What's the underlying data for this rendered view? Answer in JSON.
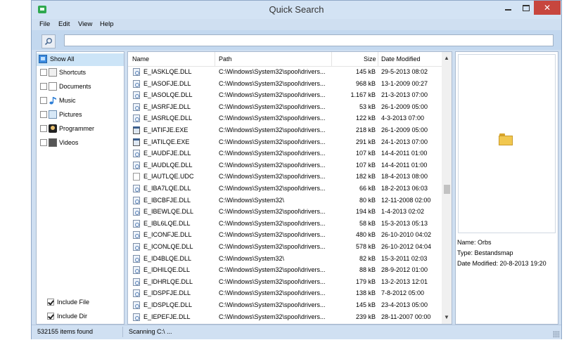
{
  "window": {
    "title": "Quick Search"
  },
  "menu": [
    "File",
    "Edit",
    "View",
    "Help"
  ],
  "search": {
    "value": "",
    "placeholder": ""
  },
  "sidebar": {
    "items": [
      {
        "label": "Show All",
        "icon": "show-all-icon",
        "selected": true,
        "checked": false
      },
      {
        "label": "Shortcuts",
        "icon": "shortcut-icon",
        "selected": false,
        "checked": false
      },
      {
        "label": "Documents",
        "icon": "document-icon",
        "selected": false,
        "checked": false
      },
      {
        "label": "Music",
        "icon": "music-icon",
        "selected": false,
        "checked": false
      },
      {
        "label": "Pictures",
        "icon": "picture-icon",
        "selected": false,
        "checked": false
      },
      {
        "label": "Programmer",
        "icon": "programmer-icon",
        "selected": false,
        "checked": false
      },
      {
        "label": "Videos",
        "icon": "video-icon",
        "selected": false,
        "checked": false
      }
    ],
    "include_file": {
      "label": "Include File",
      "checked": true
    },
    "include_dir": {
      "label": "Include Dir",
      "checked": true
    }
  },
  "table": {
    "columns": [
      "Name",
      "Path",
      "Size",
      "Date Modified"
    ],
    "rows": [
      {
        "name": "E_IASKLQE.DLL",
        "path": "C:\\Windows\\System32\\spool\\drivers...",
        "size": "145 kB",
        "date": "29-5-2013 08:02",
        "type": "dll"
      },
      {
        "name": "E_IASOFJE.DLL",
        "path": "C:\\Windows\\System32\\spool\\drivers...",
        "size": "968 kB",
        "date": "13-1-2009 00:27",
        "type": "dll"
      },
      {
        "name": "E_IASOLQE.DLL",
        "path": "C:\\Windows\\System32\\spool\\drivers...",
        "size": "1.167 kB",
        "date": "21-3-2013 07:00",
        "type": "dll"
      },
      {
        "name": "E_IASRFJE.DLL",
        "path": "C:\\Windows\\System32\\spool\\drivers...",
        "size": "53 kB",
        "date": "26-1-2009 05:00",
        "type": "dll"
      },
      {
        "name": "E_IASRLQE.DLL",
        "path": "C:\\Windows\\System32\\spool\\drivers...",
        "size": "122 kB",
        "date": "4-3-2013 07:00",
        "type": "dll"
      },
      {
        "name": "E_IATIFJE.EXE",
        "path": "C:\\Windows\\System32\\spool\\drivers...",
        "size": "218 kB",
        "date": "26-1-2009 05:00",
        "type": "exe"
      },
      {
        "name": "E_IATILQE.EXE",
        "path": "C:\\Windows\\System32\\spool\\drivers...",
        "size": "291 kB",
        "date": "24-1-2013 07:00",
        "type": "exe"
      },
      {
        "name": "E_IAUDFJE.DLL",
        "path": "C:\\Windows\\System32\\spool\\drivers...",
        "size": "107 kB",
        "date": "14-4-2011 01:00",
        "type": "dll"
      },
      {
        "name": "E_IAUDLQE.DLL",
        "path": "C:\\Windows\\System32\\spool\\drivers...",
        "size": "107 kB",
        "date": "14-4-2011 01:00",
        "type": "dll"
      },
      {
        "name": "E_IAUTLQE.UDC",
        "path": "C:\\Windows\\System32\\spool\\drivers...",
        "size": "182 kB",
        "date": "18-4-2013 08:00",
        "type": "udc"
      },
      {
        "name": "E_IBA7LQE.DLL",
        "path": "C:\\Windows\\System32\\spool\\drivers...",
        "size": "66 kB",
        "date": "18-2-2013 06:03",
        "type": "dll"
      },
      {
        "name": "E_IBCBFJE.DLL",
        "path": "C:\\Windows\\System32\\",
        "size": "80 kB",
        "date": "12-11-2008 02:00",
        "type": "dll"
      },
      {
        "name": "E_IBEWLQE.DLL",
        "path": "C:\\Windows\\System32\\spool\\drivers...",
        "size": "194 kB",
        "date": "1-4-2013 02:02",
        "type": "dll"
      },
      {
        "name": "E_IBL6LQE.DLL",
        "path": "C:\\Windows\\System32\\spool\\drivers...",
        "size": "58 kB",
        "date": "15-3-2013 05:13",
        "type": "dll"
      },
      {
        "name": "E_ICONFJE.DLL",
        "path": "C:\\Windows\\System32\\spool\\drivers...",
        "size": "480 kB",
        "date": "26-10-2010 04:02",
        "type": "dll"
      },
      {
        "name": "E_ICONLQE.DLL",
        "path": "C:\\Windows\\System32\\spool\\drivers...",
        "size": "578 kB",
        "date": "26-10-2012 04:04",
        "type": "dll"
      },
      {
        "name": "E_ID4BLQE.DLL",
        "path": "C:\\Windows\\System32\\",
        "size": "82 kB",
        "date": "15-3-2011 02:03",
        "type": "dll"
      },
      {
        "name": "E_IDHILQE.DLL",
        "path": "C:\\Windows\\System32\\spool\\drivers...",
        "size": "88 kB",
        "date": "28-9-2012 01:00",
        "type": "dll"
      },
      {
        "name": "E_IDHRLQE.DLL",
        "path": "C:\\Windows\\System32\\spool\\drivers...",
        "size": "179 kB",
        "date": "13-2-2013 12:01",
        "type": "dll"
      },
      {
        "name": "E_IDSPFJE.DLL",
        "path": "C:\\Windows\\System32\\spool\\drivers...",
        "size": "138 kB",
        "date": "7-8-2012 05:00",
        "type": "dll"
      },
      {
        "name": "E_IDSPLQE.DLL",
        "path": "C:\\Windows\\System32\\spool\\drivers...",
        "size": "145 kB",
        "date": "23-4-2013 05:00",
        "type": "dll"
      },
      {
        "name": "E_IEPEFJE.DLL",
        "path": "C:\\Windows\\System32\\spool\\drivers...",
        "size": "239 kB",
        "date": "28-11-2007 00:00",
        "type": "dll"
      }
    ]
  },
  "preview": {
    "icon": "folder-icon",
    "name_line": "Name:  Orbs",
    "type_line": "Type: Bestandsmap",
    "date_line": "Date Modified: 20-8-2013 19:20"
  },
  "status": {
    "count": "532155 items found",
    "scan": "Scanning C:\\ ..."
  },
  "colors": {
    "frame": "#cfdff1",
    "selection": "#cce4f7",
    "close": "#c7463e",
    "folder": "#f1c74f"
  }
}
